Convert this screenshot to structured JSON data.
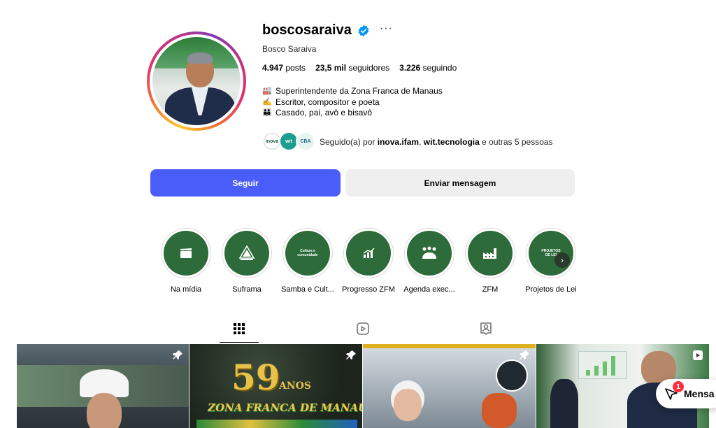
{
  "profile": {
    "username": "boscosaraiva",
    "more_icon": "more-horizontal-icon",
    "full_name": "Bosco Saraiva",
    "verified_color": "#0095f6"
  },
  "stats": {
    "posts_value": "4.947",
    "posts_label": "posts",
    "followers_value": "23,5 mil",
    "followers_label": "seguidores",
    "following_value": "3.226",
    "following_label": "seguindo"
  },
  "bio": {
    "lines": [
      {
        "icon": "factory-icon",
        "emoji": "🏭",
        "text": "Superintendente da Zona Franca de Manaus"
      },
      {
        "icon": "writing-hand-icon",
        "emoji": "✍️",
        "text": "Escritor, compositor e poeta"
      },
      {
        "icon": "family-icon",
        "emoji": "👪",
        "text": "Casado, pai, avô e bisavô"
      }
    ]
  },
  "followed_by": {
    "prefix": "Seguido(a) por",
    "user1": "inova.ifam",
    "sep": ",",
    "user2": "wit.tecnologia",
    "suffix": "e outras 5 pessoas",
    "mini_labels": [
      "inova",
      "wit",
      "CBA"
    ]
  },
  "actions": {
    "follow_label": "Seguir",
    "message_label": "Enviar mensagem",
    "follow_color": "#4a5df9"
  },
  "highlights": [
    {
      "label": "Na mídia",
      "icon": "clapperboard-icon"
    },
    {
      "label": "Suframa",
      "icon": "suframa-logo-icon"
    },
    {
      "label": "Samba e Cult...",
      "icon": "text-icon",
      "inner_text": "Cultura e comunidade"
    },
    {
      "label": "Progresso ZFM",
      "icon": "bar-chart-icon"
    },
    {
      "label": "Agenda exec...",
      "icon": "handshake-people-icon"
    },
    {
      "label": "ZFM",
      "icon": "factory-icon"
    },
    {
      "label": "Projetos de Lei",
      "icon": "text-icon",
      "inner_text": "PROJETOS DE LEI"
    }
  ],
  "tabs": [
    {
      "name": "posts",
      "icon": "grid-icon",
      "active": true
    },
    {
      "name": "reels",
      "icon": "reels-icon",
      "active": false
    },
    {
      "name": "tagged",
      "icon": "tagged-user-icon",
      "active": false
    }
  ],
  "posts": {
    "post2_title": "59",
    "post2_subtitle": "ANOS",
    "post2_caption": "ZONA FRANCA DE MANAUS"
  },
  "messages": {
    "label": "Mensa",
    "badge_count": "1"
  }
}
